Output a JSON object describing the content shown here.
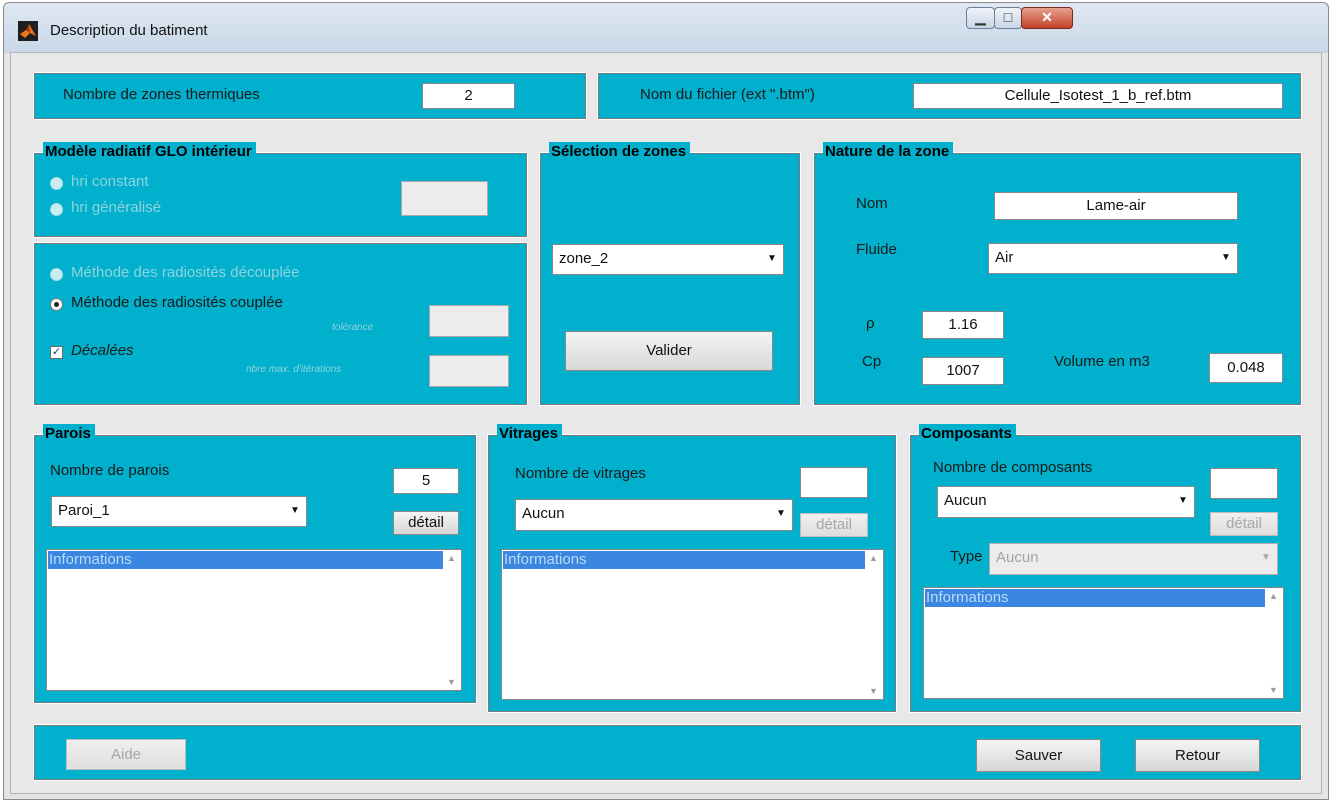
{
  "window": {
    "title": "Description du batiment"
  },
  "top_left": {
    "label": "Nombre de zones thermiques",
    "value": "2"
  },
  "top_right": {
    "label": "Nom du fichier (ext \".btm\")",
    "value": "Cellule_Isotest_1_b_ref.btm"
  },
  "radiative": {
    "title": "Modèle radiatif GLO intérieur",
    "option_1": "hri constant",
    "option_2": "hri généralisé",
    "method_1": "Méthode des radiosités découplée",
    "method_2": "Méthode des radiosités couplée",
    "method_selected": "Méthode des radiosités couplée",
    "tolerance_label": "tolérance",
    "decalees_label": "Décalées",
    "decalees_checked": true,
    "max_iter_label": "nbre max. d'itérations"
  },
  "zone_selection": {
    "title": "Sélection de zones",
    "selected": "zone_2",
    "validate_label": "Valider"
  },
  "zone_nature": {
    "title": "Nature de la zone",
    "name_label": "Nom",
    "name_value": "Lame-air",
    "fluid_label": "Fluide",
    "fluid_value": "Air",
    "rho_label": "ρ",
    "rho_value": "1.16",
    "cp_label": "Cp",
    "cp_value": "1007",
    "volume_label": "Volume en m3",
    "volume_value": "0.048"
  },
  "walls": {
    "title": "Parois",
    "count_label": "Nombre de parois",
    "count_value": "5",
    "selected": "Paroi_1",
    "detail_label": "détail",
    "info_label": "Informations"
  },
  "glazing": {
    "title": "Vitrages",
    "count_label": "Nombre de vitrages",
    "count_value": "",
    "selected": "Aucun",
    "detail_label": "détail",
    "info_label": "Informations"
  },
  "components": {
    "title": "Composants",
    "count_label": "Nombre de composants",
    "count_value": "",
    "selected": "Aucun",
    "detail_label": "détail",
    "type_label": "Type",
    "type_value": "Aucun",
    "info_label": "Informations"
  },
  "footer": {
    "help_label": "Aide",
    "save_label": "Sauver",
    "back_label": "Retour"
  },
  "colors": {
    "panel": "#00b0cc",
    "selection": "#3b86e0",
    "window_bg": "#e8e8e8"
  },
  "icons": [
    "matlab-icon",
    "minimize-icon",
    "maximize-icon",
    "close-icon",
    "chevron-down-icon",
    "scroll-up-icon",
    "scroll-down-icon"
  ]
}
